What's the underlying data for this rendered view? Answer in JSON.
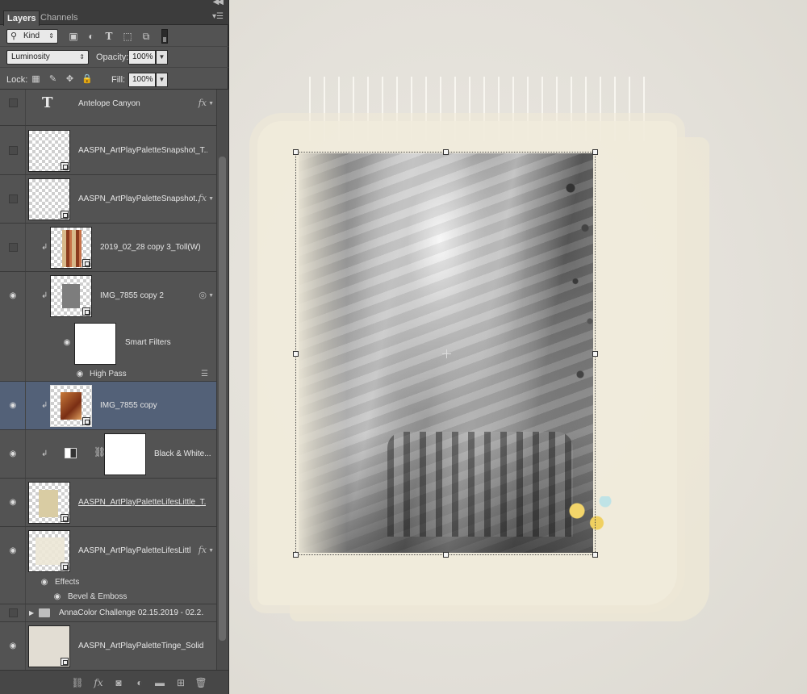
{
  "panel": {
    "tabs": [
      "Layers",
      "Channels"
    ],
    "filter": {
      "kind_label": "Kind"
    },
    "blend_mode": "Luminosity",
    "opacity_label": "Opacity:",
    "opacity_value": "100%",
    "lock_label": "Lock:",
    "fill_label": "Fill:",
    "fill_value": "100%"
  },
  "layers": [
    {
      "name": "Antelope Canyon",
      "visible": false,
      "type": "text",
      "fx": true
    },
    {
      "name": "AASPN_ArtPlayPaletteSnapshot_T...",
      "visible": false,
      "type": "smart",
      "fx": false
    },
    {
      "name": "AASPN_ArtPlayPaletteSnapshot...",
      "visible": false,
      "type": "smart",
      "fx": true
    },
    {
      "name": "2019_02_28 copy 3_Toll(W)",
      "visible": false,
      "type": "smart",
      "clipped": true
    },
    {
      "name": "IMG_7855 copy 2",
      "visible": true,
      "type": "smart",
      "clipped": true,
      "smart_filters": "Smart Filters",
      "filter_items": [
        "High Pass"
      ]
    },
    {
      "name": "IMG_7855 copy",
      "visible": true,
      "type": "smart",
      "clipped": true,
      "selected": true
    },
    {
      "name": "Black & White...",
      "visible": true,
      "type": "adjustment",
      "clipped": true
    },
    {
      "name": "AASPN_ArtPlayPaletteLifesLittle_T...",
      "visible": true,
      "type": "smart",
      "underlined": true
    },
    {
      "name": "AASPN_ArtPlayPaletteLifesLittl...",
      "visible": true,
      "type": "smart",
      "fx": true,
      "effects_label": "Effects",
      "effects": [
        "Bevel & Emboss"
      ]
    },
    {
      "name": "AnnaColor Challenge 02.15.2019 - 02.2...",
      "visible": false,
      "type": "group"
    },
    {
      "name": "AASPN_ArtPlayPaletteTinge_Solid...",
      "visible": true,
      "type": "smart"
    }
  ],
  "icons": {
    "fx": "fx",
    "text_layer": "T"
  }
}
